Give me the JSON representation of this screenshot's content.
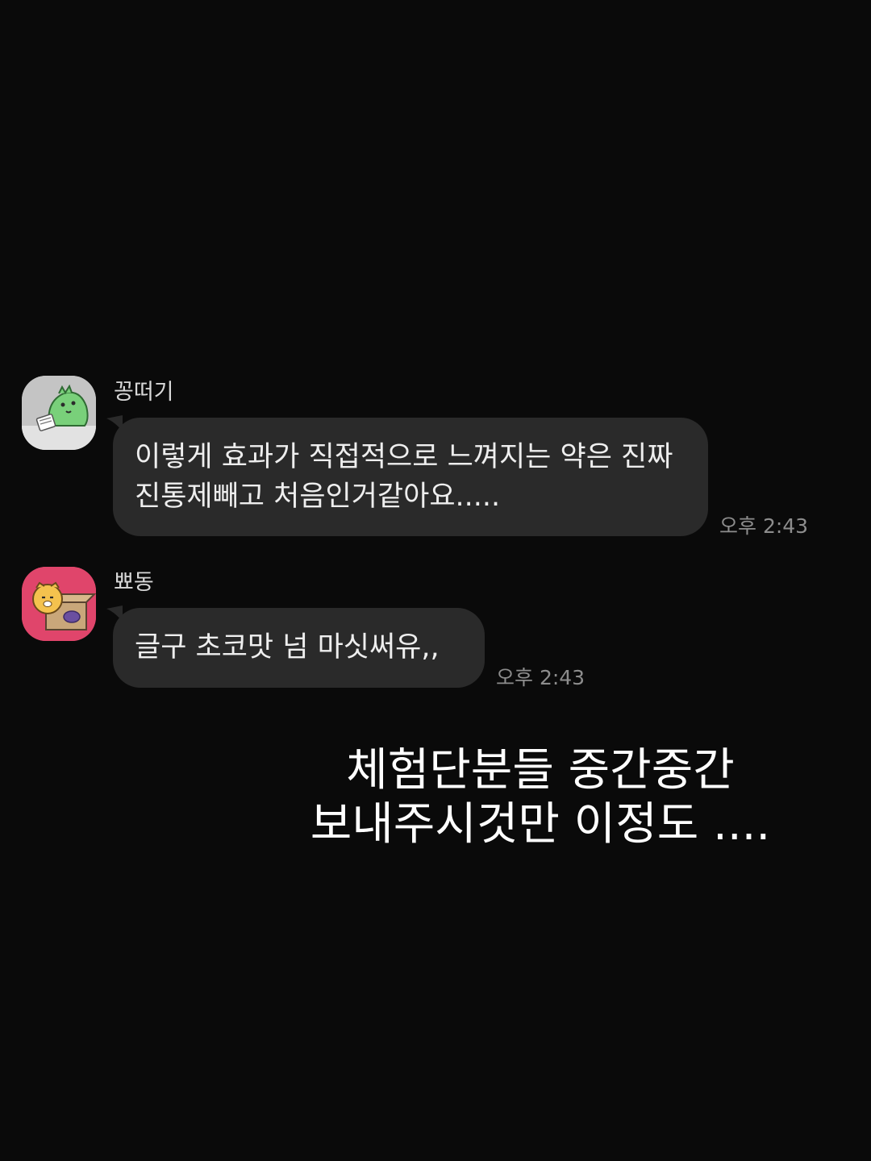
{
  "messages": [
    {
      "sender": "꽁떠기",
      "avatar_icon": "green-dinosaur-sticker-icon",
      "text": "이렇게 효과가 직접적으로 느껴지는 약은 진짜 진통제빼고 처음인거같아요.....",
      "time": "오후 2:43"
    },
    {
      "sender": "뾰동",
      "avatar_icon": "yellow-lion-in-box-sticker-icon",
      "text": "글구 초코맛 넘 마싯써유,,",
      "time": "오후 2:43"
    }
  ],
  "caption": {
    "line1": "체험단분들 중간중간",
    "line2": "보내주시것만 이정도 ...."
  },
  "colors": {
    "background": "#0a0a0a",
    "bubble": "#2a2a2a",
    "avatar1_bg": "#bdbdbd",
    "avatar2_bg": "#e0456b"
  }
}
